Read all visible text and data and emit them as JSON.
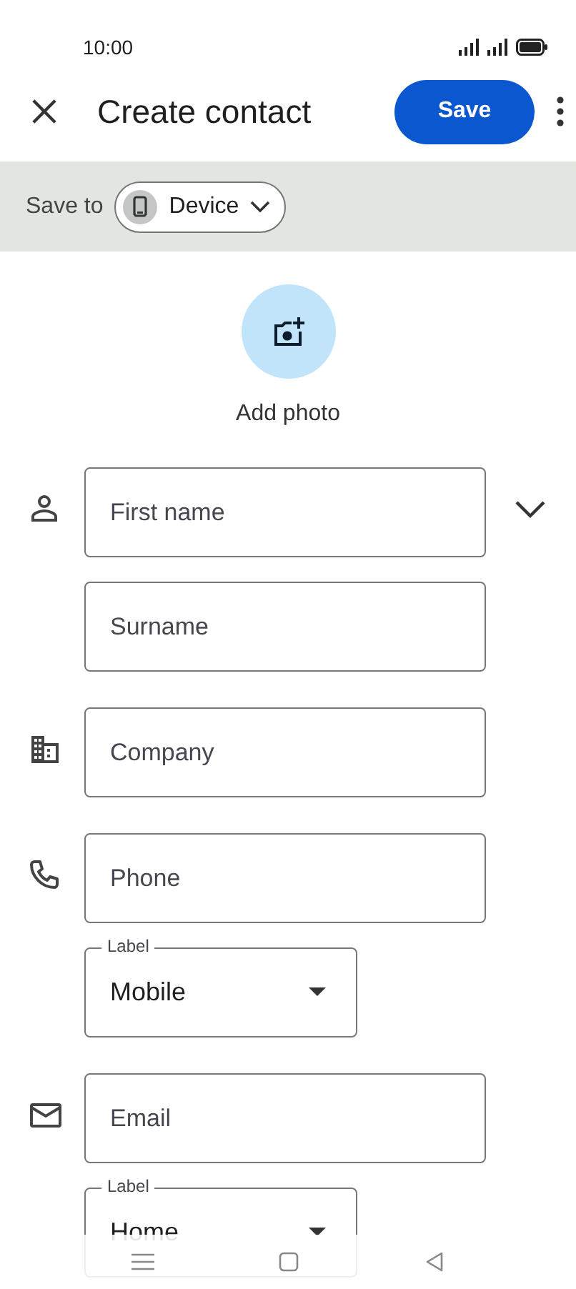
{
  "status_bar": {
    "time": "10:00"
  },
  "header": {
    "title": "Create contact",
    "save_button": "Save"
  },
  "save_to": {
    "label": "Save to",
    "account": "Device"
  },
  "photo": {
    "label": "Add photo"
  },
  "groups": [
    {
      "kind": "person",
      "expandable": true,
      "fields": [
        {
          "kind": "text",
          "placeholder": "First name"
        },
        {
          "kind": "text",
          "placeholder": "Surname"
        }
      ]
    },
    {
      "kind": "company",
      "expandable": false,
      "fields": [
        {
          "kind": "text",
          "placeholder": "Company"
        }
      ]
    },
    {
      "kind": "phone",
      "expandable": false,
      "fields": [
        {
          "kind": "text",
          "placeholder": "Phone"
        },
        {
          "kind": "select",
          "label": "Label",
          "value": "Mobile"
        }
      ]
    },
    {
      "kind": "email",
      "expandable": false,
      "fields": [
        {
          "kind": "text",
          "placeholder": "Email"
        },
        {
          "kind": "select",
          "label": "Label",
          "value": "Home"
        }
      ]
    }
  ]
}
